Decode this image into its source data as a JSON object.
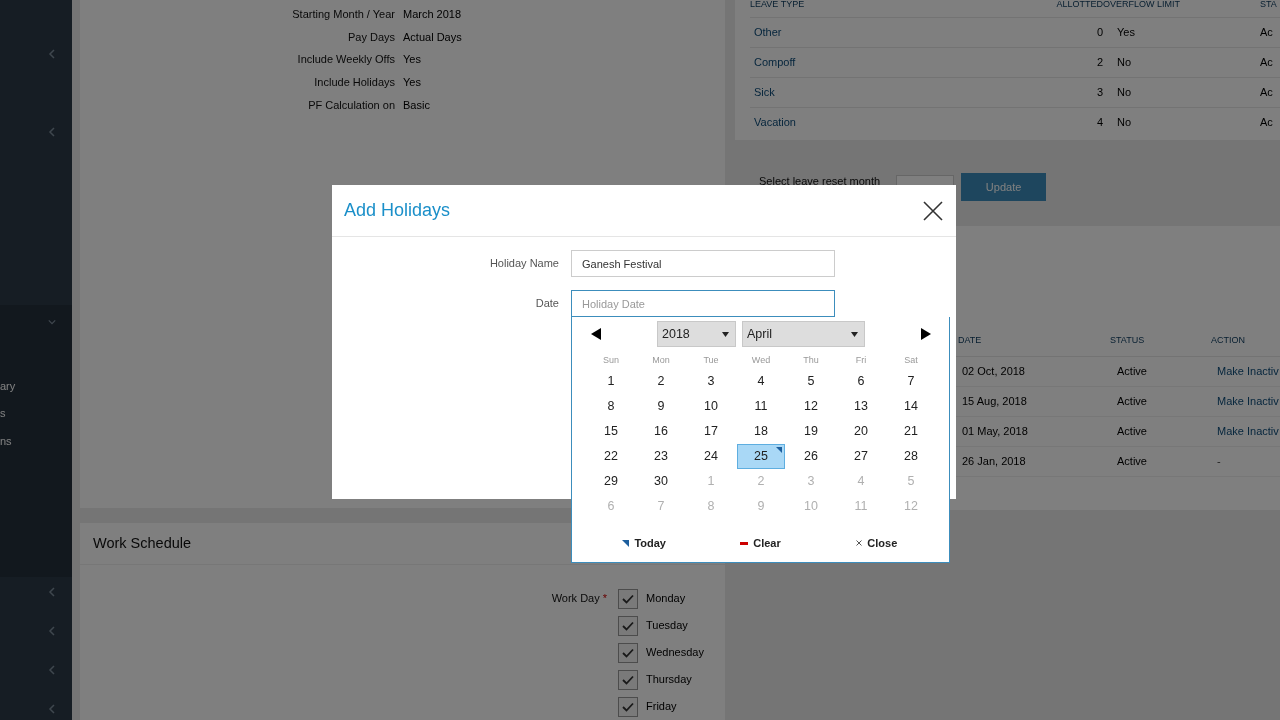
{
  "sidebar": {
    "items": [
      {
        "label": "ary"
      },
      {
        "label": "s"
      },
      {
        "label": "ns"
      }
    ]
  },
  "payroll_details": [
    {
      "label": "Starting Month / Year",
      "value": "March 2018"
    },
    {
      "label": "Pay Days",
      "value": "Actual Days"
    },
    {
      "label": "Include Weekly Offs",
      "value": "Yes"
    },
    {
      "label": "Include Holidays",
      "value": "Yes"
    },
    {
      "label": "PF Calculation on",
      "value": "Basic"
    }
  ],
  "leave_types": {
    "columns": [
      "LEAVE TYPE",
      "ALLOTTED",
      "OVERFLOW LIMIT",
      "STA"
    ],
    "rows": [
      {
        "name": "Other",
        "allotted": "0",
        "overflow": "Yes",
        "status": "Ac"
      },
      {
        "name": "Compoff",
        "allotted": "2",
        "overflow": "No",
        "status": "Ac"
      },
      {
        "name": "Sick",
        "allotted": "3",
        "overflow": "No",
        "status": "Ac"
      },
      {
        "name": "Vacation",
        "allotted": "4",
        "overflow": "No",
        "status": "Ac"
      }
    ]
  },
  "leave_reset": {
    "label": "Select leave reset month",
    "button": "Update"
  },
  "holidays": {
    "columns": [
      "DATE",
      "STATUS",
      "ACTION"
    ],
    "rows": [
      {
        "date": "02 Oct, 2018",
        "status": "Active",
        "action": "Make Inactiv",
        "action_is_link": true
      },
      {
        "date": "15 Aug, 2018",
        "status": "Active",
        "action": "Make Inactiv",
        "action_is_link": true
      },
      {
        "date": "01 May, 2018",
        "status": "Active",
        "action": "Make Inactiv",
        "action_is_link": true
      },
      {
        "date": "26 Jan, 2018",
        "status": "Active",
        "action": "-",
        "action_is_link": false
      }
    ]
  },
  "work_schedule": {
    "title": "Work Schedule",
    "label": "Work Day",
    "required_mark": "*",
    "days": [
      {
        "label": "Monday",
        "checked": true
      },
      {
        "label": "Tuesday",
        "checked": true
      },
      {
        "label": "Wednesday",
        "checked": true
      },
      {
        "label": "Thursday",
        "checked": true
      },
      {
        "label": "Friday",
        "checked": true
      }
    ]
  },
  "modal": {
    "title": "Add Holidays",
    "fields": [
      {
        "label": "Holiday Name",
        "value": "Ganesh Festival",
        "focused": false
      },
      {
        "label": "Date",
        "placeholder": "Holiday Date",
        "focused": true
      }
    ],
    "datepicker": {
      "year": "2018",
      "month": "April",
      "weekdays": [
        "Sun",
        "Mon",
        "Tue",
        "Wed",
        "Thu",
        "Fri",
        "Sat"
      ],
      "days": [
        {
          "label": "1",
          "muted": false,
          "selected": false,
          "today": false
        },
        {
          "label": "2",
          "muted": false,
          "selected": false,
          "today": false
        },
        {
          "label": "3",
          "muted": false,
          "selected": false,
          "today": false
        },
        {
          "label": "4",
          "muted": false,
          "selected": false,
          "today": false
        },
        {
          "label": "5",
          "muted": false,
          "selected": false,
          "today": false
        },
        {
          "label": "6",
          "muted": false,
          "selected": false,
          "today": false
        },
        {
          "label": "7",
          "muted": false,
          "selected": false,
          "today": false
        },
        {
          "label": "8",
          "muted": false,
          "selected": false,
          "today": false
        },
        {
          "label": "9",
          "muted": false,
          "selected": false,
          "today": false
        },
        {
          "label": "10",
          "muted": false,
          "selected": false,
          "today": false
        },
        {
          "label": "11",
          "muted": false,
          "selected": false,
          "today": false
        },
        {
          "label": "12",
          "muted": false,
          "selected": false,
          "today": false
        },
        {
          "label": "13",
          "muted": false,
          "selected": false,
          "today": false
        },
        {
          "label": "14",
          "muted": false,
          "selected": false,
          "today": false
        },
        {
          "label": "15",
          "muted": false,
          "selected": false,
          "today": false
        },
        {
          "label": "16",
          "muted": false,
          "selected": false,
          "today": false
        },
        {
          "label": "17",
          "muted": false,
          "selected": false,
          "today": false
        },
        {
          "label": "18",
          "muted": false,
          "selected": false,
          "today": false
        },
        {
          "label": "19",
          "muted": false,
          "selected": false,
          "today": false
        },
        {
          "label": "20",
          "muted": false,
          "selected": false,
          "today": false
        },
        {
          "label": "21",
          "muted": false,
          "selected": false,
          "today": false
        },
        {
          "label": "22",
          "muted": false,
          "selected": false,
          "today": false
        },
        {
          "label": "23",
          "muted": false,
          "selected": false,
          "today": false
        },
        {
          "label": "24",
          "muted": false,
          "selected": false,
          "today": false
        },
        {
          "label": "25",
          "muted": false,
          "selected": true,
          "today": true
        },
        {
          "label": "26",
          "muted": false,
          "selected": false,
          "today": false
        },
        {
          "label": "27",
          "muted": false,
          "selected": false,
          "today": false
        },
        {
          "label": "28",
          "muted": false,
          "selected": false,
          "today": false
        },
        {
          "label": "29",
          "muted": false,
          "selected": false,
          "today": false
        },
        {
          "label": "30",
          "muted": false,
          "selected": false,
          "today": false
        },
        {
          "label": "1",
          "muted": true,
          "selected": false,
          "today": false
        },
        {
          "label": "2",
          "muted": true,
          "selected": false,
          "today": false
        },
        {
          "label": "3",
          "muted": true,
          "selected": false,
          "today": false
        },
        {
          "label": "4",
          "muted": true,
          "selected": false,
          "today": false
        },
        {
          "label": "5",
          "muted": true,
          "selected": false,
          "today": false
        },
        {
          "label": "6",
          "muted": true,
          "selected": false,
          "today": false
        },
        {
          "label": "7",
          "muted": true,
          "selected": false,
          "today": false
        },
        {
          "label": "8",
          "muted": true,
          "selected": false,
          "today": false
        },
        {
          "label": "9",
          "muted": true,
          "selected": false,
          "today": false
        },
        {
          "label": "10",
          "muted": true,
          "selected": false,
          "today": false
        },
        {
          "label": "11",
          "muted": true,
          "selected": false,
          "today": false
        },
        {
          "label": "12",
          "muted": true,
          "selected": false,
          "today": false
        }
      ],
      "footer": [
        {
          "kind": "today",
          "label": "Today"
        },
        {
          "kind": "clear",
          "label": "Clear"
        },
        {
          "kind": "close",
          "label": "Close"
        }
      ]
    }
  }
}
